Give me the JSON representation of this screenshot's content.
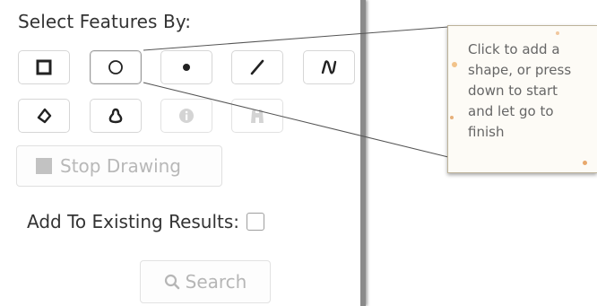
{
  "panel": {
    "title": "Select Features By:",
    "tools": [
      {
        "name": "rectangle",
        "icon": "square-icon",
        "active": false,
        "enabled": true
      },
      {
        "name": "circle",
        "icon": "circle-icon",
        "active": true,
        "enabled": true
      },
      {
        "name": "point",
        "icon": "point-icon",
        "active": false,
        "enabled": true
      },
      {
        "name": "line",
        "icon": "line-icon",
        "active": false,
        "enabled": true
      },
      {
        "name": "freehand-line",
        "icon": "freehand-line-icon",
        "active": false,
        "enabled": true
      },
      {
        "name": "polygon",
        "icon": "polygon-icon",
        "active": false,
        "enabled": true
      },
      {
        "name": "freehand-polygon",
        "icon": "freehand-polygon-icon",
        "active": false,
        "enabled": true
      },
      {
        "name": "info",
        "icon": "info-icon",
        "active": false,
        "enabled": false
      },
      {
        "name": "binoculars",
        "icon": "binoculars-icon",
        "active": false,
        "enabled": false
      }
    ],
    "stop_drawing_label": "Stop Drawing",
    "add_to_existing_label": "Add To Existing Results:",
    "add_to_existing_checked": false,
    "search_label": "Search"
  },
  "tooltip": {
    "lines": [
      "Click to add a",
      "shape, or press",
      "down to start",
      "and let go to",
      "finish"
    ]
  },
  "colors": {
    "text": "#333333",
    "disabled_text": "#b8b8b8",
    "tooltip_bg": "#fdfbf6",
    "callout_line": "#555555"
  }
}
